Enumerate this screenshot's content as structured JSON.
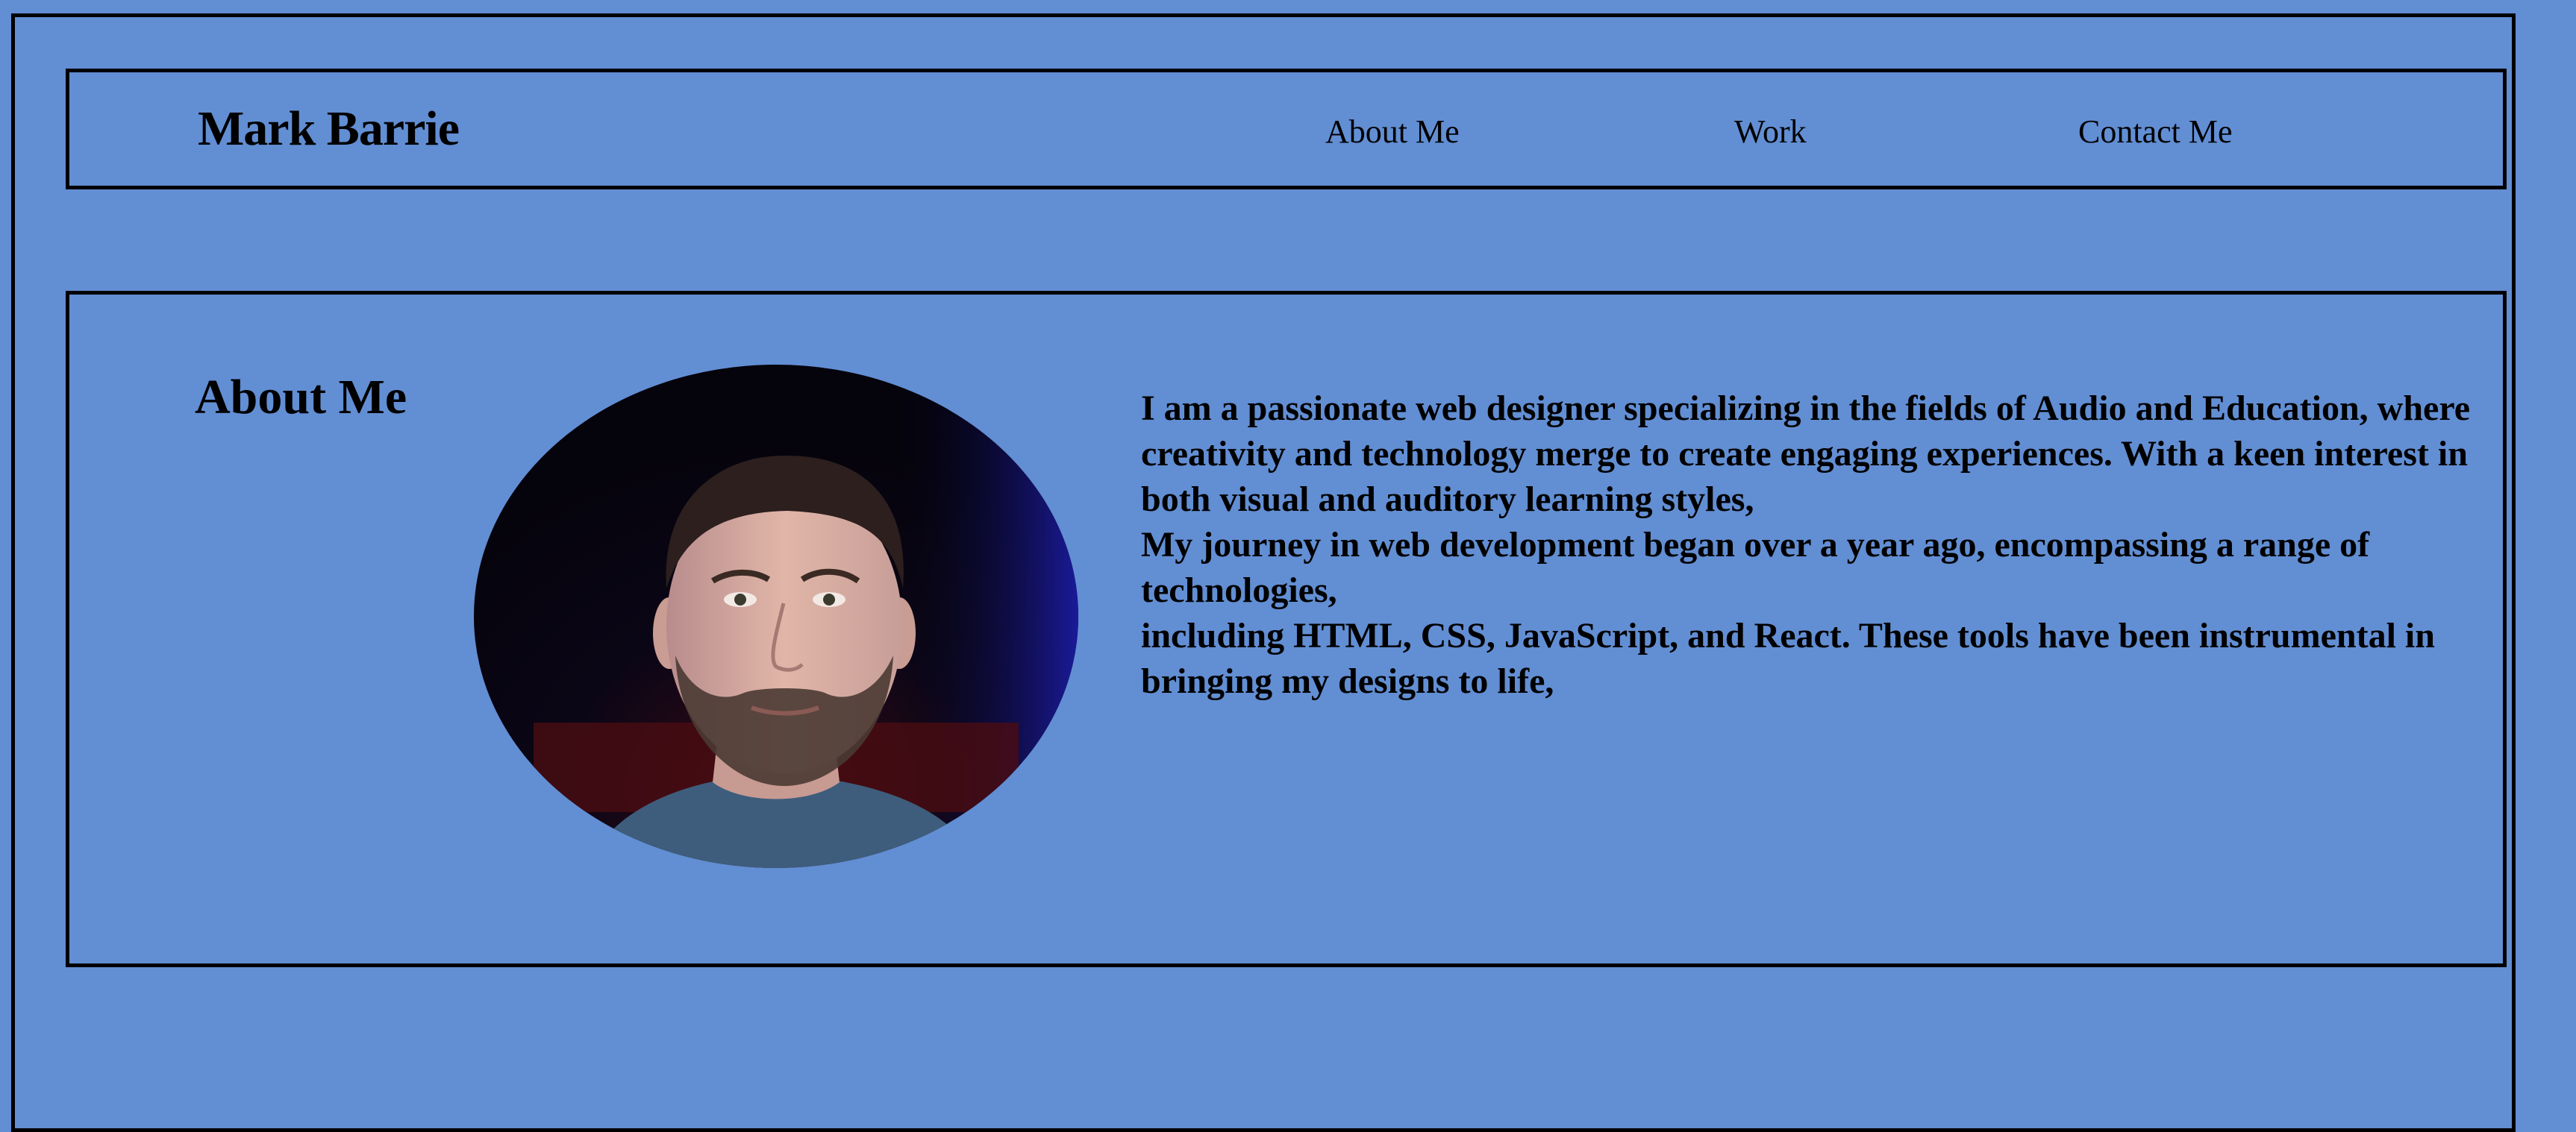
{
  "header": {
    "brand": "Mark Barrie",
    "nav": [
      {
        "label": "About Me"
      },
      {
        "label": "Work"
      },
      {
        "label": "Contact Me"
      }
    ]
  },
  "about": {
    "title": "About Me",
    "bio_lines": [
      "I am a passionate web designer specializing in the fields of Audio and Education, where creativity and technology merge to create engaging experiences. With a keen interest in both visual and auditory learning styles,",
      "My journey in web development began over a year ago, encompassing a range of technologies,",
      "including HTML, CSS, JavaScript, and React. These tools have been instrumental in bringing my designs to life,"
    ]
  },
  "colors": {
    "background": "#628ed3",
    "border": "#000000",
    "text": "#000000"
  }
}
